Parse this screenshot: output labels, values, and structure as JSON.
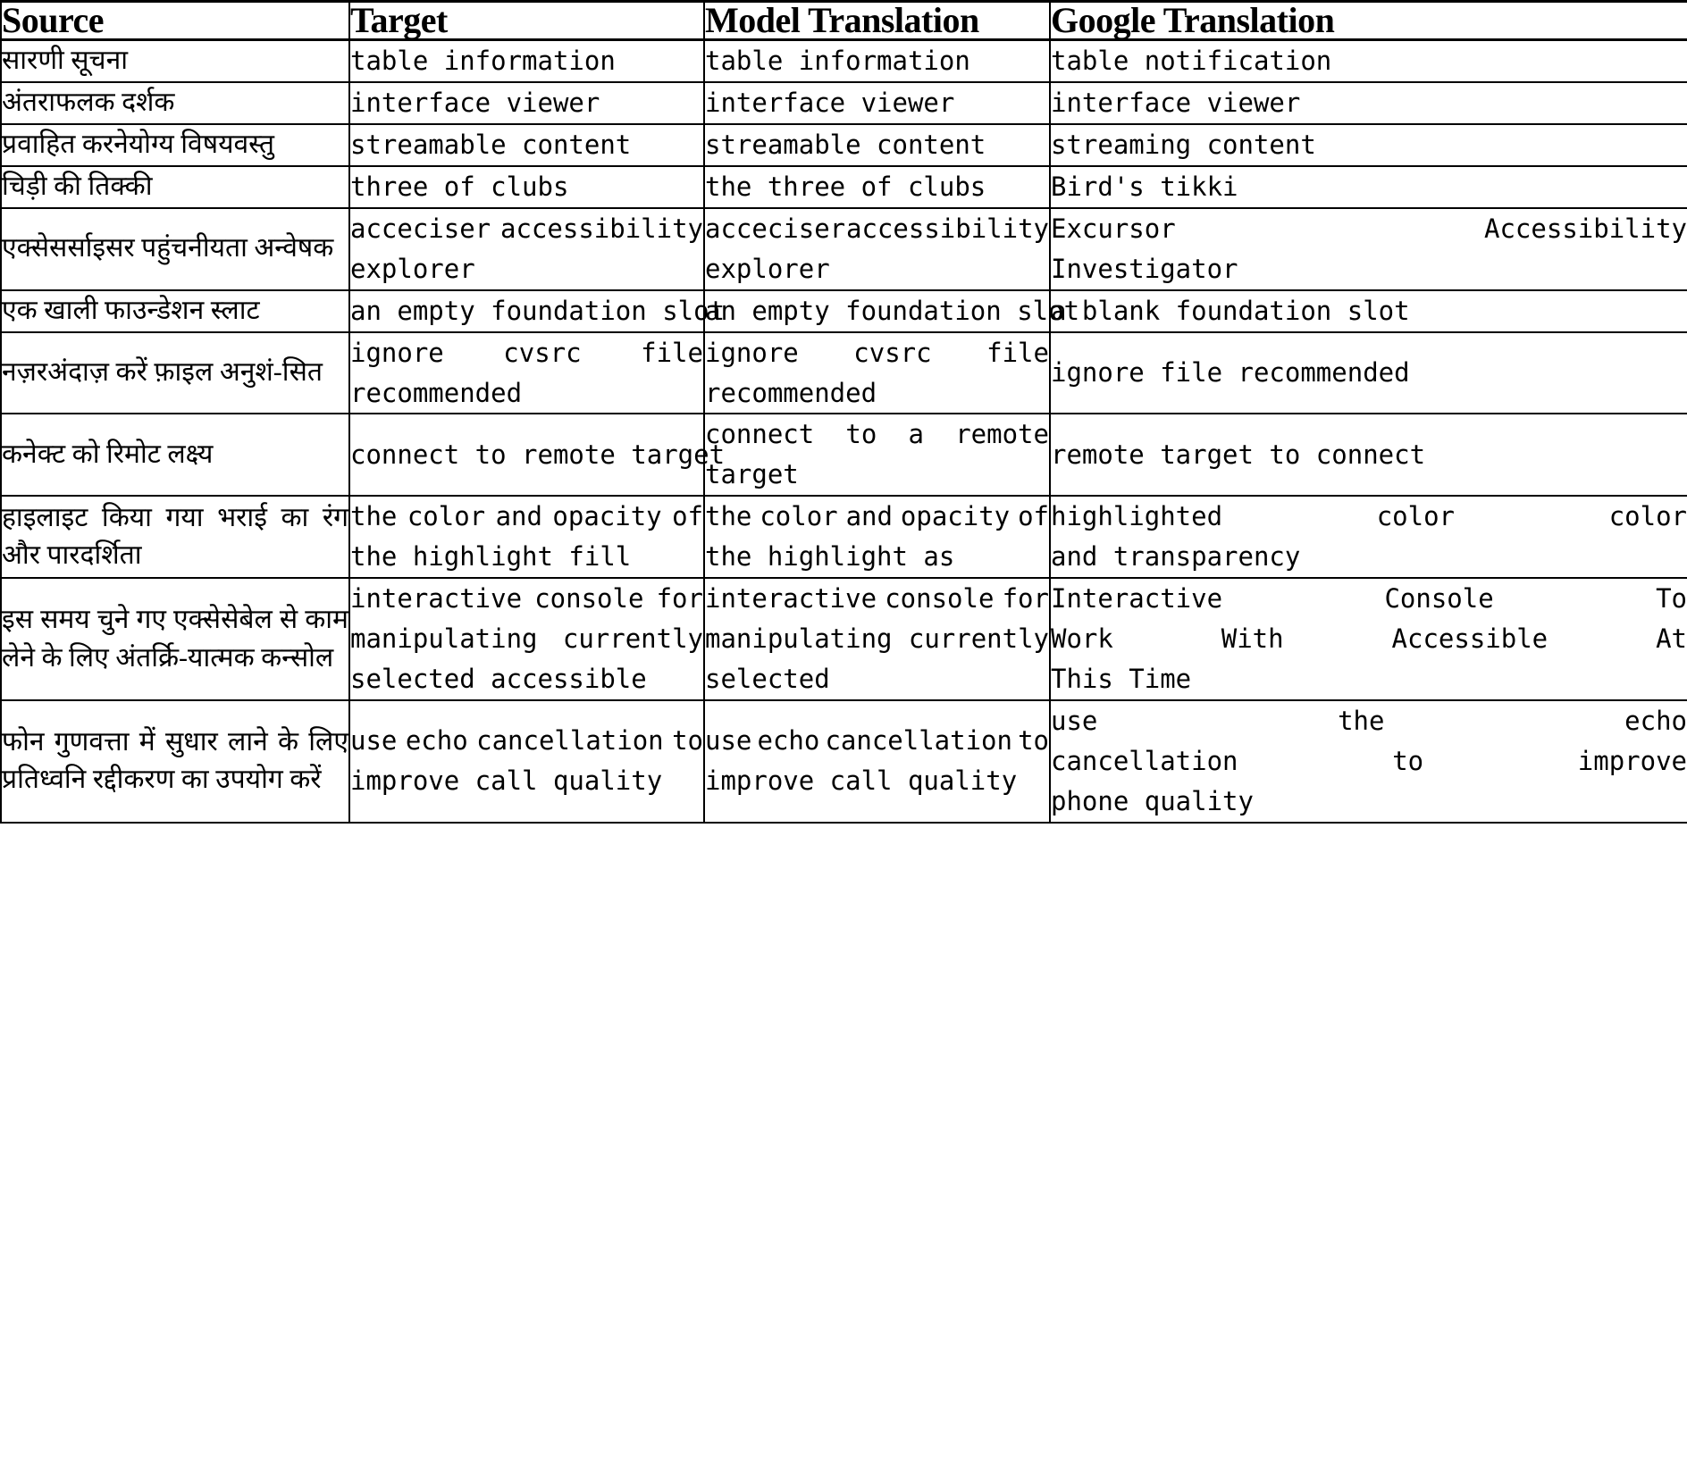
{
  "table": {
    "headers": [
      "Source",
      "Target",
      "Model Translation",
      "Google Translation"
    ],
    "rows": [
      {
        "source": "सारणी सूचना",
        "target": "table information",
        "model": "table information",
        "google": "table notification"
      },
      {
        "source": "अंतराफलक दर्शक",
        "target": "interface viewer",
        "model": "interface viewer",
        "google": "interface viewer"
      },
      {
        "source": "प्रवाहित करनेयोग्य विषयवस्तु",
        "target": "streamable content",
        "model": "streamable content",
        "google": "streaming content"
      },
      {
        "source": "चिड़ी की तिक्की",
        "target": "three of clubs",
        "model": "the three of clubs",
        "google": "Bird's tikki"
      },
      {
        "source": "एक्सेसर्साइसर पहुंचनीयता अन्वेषक",
        "target": "acceciser accessibility explorer",
        "model": "acceciser accessibility explorer",
        "google": "Excursor Accessibility Investigator"
      },
      {
        "source": "एक खाली फाउन्डेशन स्लाट",
        "target": "an empty foundation slot",
        "model": "an empty foundation slot",
        "google": "a blank foundation slot"
      },
      {
        "source": "नज़रअंदाज़ करें फ़ाइल अनुशं-सित",
        "target": "ignore cvsrc file recommended",
        "model": "ignore cvsrc file recommended",
        "google": "ignore file recommended"
      },
      {
        "source": "कनेक्ट को रिमोट लक्ष्य",
        "target": "connect to remote target",
        "model": "connect to a remote target",
        "google": "remote target to connect"
      },
      {
        "source": "हाइलाइट किया गया भराई का रंग और पारदर्शिता",
        "target": "the color and opacity of the highlight fill",
        "model": "the color and opacity of the highlight as",
        "google": "highlighted color color and transparency"
      },
      {
        "source": "इस समय चुने गए एक्सेसेबेल से काम लेने के लिए अंतर्क्रि-यात्मक कन्सोल",
        "target": "interactive console for manipulating currently selected accessible",
        "model": "interactive console for manipulating currently selected",
        "google": "Interactive Console To Work With Accessible At This Time"
      },
      {
        "source": "फोन गुणवत्ता में सुधार लाने के लिए प्रतिध्वनि रद्दीकरण का उपयोग करें",
        "target": "use echo cancellation to improve call quality",
        "model": "use echo cancellation to improve call quality",
        "google": "use the echo cancellation to improve phone quality"
      }
    ]
  },
  "colors": {
    "border": "#000000",
    "text": "#000000",
    "background": "#ffffff"
  }
}
